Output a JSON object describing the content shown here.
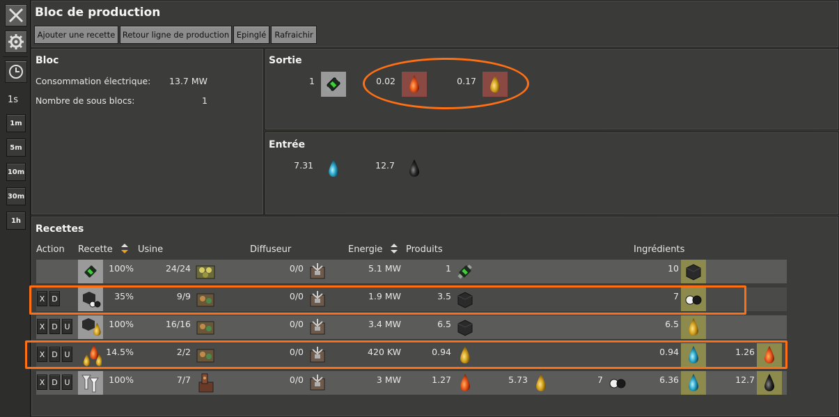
{
  "window": {
    "title": "Bloc de production"
  },
  "toolbar": {
    "buttons": [
      "Ajouter une recette",
      "Retour ligne de production",
      "Epinglé",
      "Rafraichir"
    ]
  },
  "sidebar": {
    "time_label": "1s",
    "time_buttons": [
      "1m",
      "5m",
      "10m",
      "30m",
      "1h"
    ]
  },
  "bloc": {
    "heading": "Bloc",
    "power_label": "Consommation électrique:",
    "power_value": "13.7 MW",
    "subblocks_label": "Nombre de sous blocs:",
    "subblocks_value": "1"
  },
  "sortie": {
    "heading": "Sortie",
    "items": [
      {
        "value": "1",
        "icon": "battery-icon"
      },
      {
        "value": "0.02",
        "icon": "heavy-oil-drop-icon"
      },
      {
        "value": "0.17",
        "icon": "light-oil-drop-icon"
      }
    ]
  },
  "entree": {
    "heading": "Entrée",
    "items": [
      {
        "value": "7.31",
        "icon": "water-drop-icon"
      },
      {
        "value": "12.7",
        "icon": "crude-oil-drop-icon"
      }
    ]
  },
  "recettes": {
    "heading": "Recettes",
    "columns": {
      "action": "Action",
      "recette": "Recette",
      "usine": "Usine",
      "diffuseur": "Diffuseur",
      "energie": "Energie",
      "produits": "Produits",
      "ingredients": "Ingrédients"
    },
    "rows": [
      {
        "actions": [],
        "percent": "100%",
        "usine": "24/24",
        "diffuseur": "0/0",
        "energie": "5.1 MW",
        "products": [
          {
            "value": "1",
            "icon": "battery"
          }
        ],
        "ingredients": [
          {
            "value": "10",
            "icon": "coal"
          }
        ]
      },
      {
        "actions": [
          "X",
          "D"
        ],
        "percent": "35%",
        "usine": "9/9",
        "diffuseur": "0/0",
        "energie": "1.9 MW",
        "products": [
          {
            "value": "3.5",
            "icon": "coal"
          }
        ],
        "ingredients": [
          {
            "value": "7",
            "icon": "sulfur"
          }
        ]
      },
      {
        "actions": [
          "X",
          "D",
          "U"
        ],
        "percent": "100%",
        "usine": "16/16",
        "diffuseur": "0/0",
        "energie": "3.4 MW",
        "products": [
          {
            "value": "6.5",
            "icon": "coal"
          }
        ],
        "ingredients": [
          {
            "value": "6.5",
            "icon": "light-oil"
          }
        ]
      },
      {
        "actions": [
          "X",
          "D",
          "U"
        ],
        "percent": "14.5%",
        "usine": "2/2",
        "diffuseur": "0/0",
        "energie": "420 KW",
        "products": [
          {
            "value": "0.94",
            "icon": "light-oil"
          }
        ],
        "ingredients": [
          {
            "value": "0.94",
            "icon": "water"
          },
          {
            "value": "1.26",
            "icon": "heavy-oil"
          }
        ]
      },
      {
        "actions": [
          "X",
          "D",
          "U"
        ],
        "percent": "100%",
        "usine": "7/7",
        "diffuseur": "0/0",
        "energie": "3 MW",
        "products": [
          {
            "value": "1.27",
            "icon": "heavy-oil"
          },
          {
            "value": "5.73",
            "icon": "light-oil"
          },
          {
            "value": "7",
            "icon": "sulfur"
          }
        ],
        "ingredients": [
          {
            "value": "6.36",
            "icon": "water"
          },
          {
            "value": "12.7",
            "icon": "crude-oil"
          }
        ]
      }
    ]
  },
  "colors": {
    "highlight": "#ff6f14",
    "panel": "#3c3c3a",
    "row_light": "#5b5b59",
    "row_dark": "#4a4a48",
    "output_red": "#8a4a43",
    "ingredient_yellow": "#8d8a4e"
  }
}
